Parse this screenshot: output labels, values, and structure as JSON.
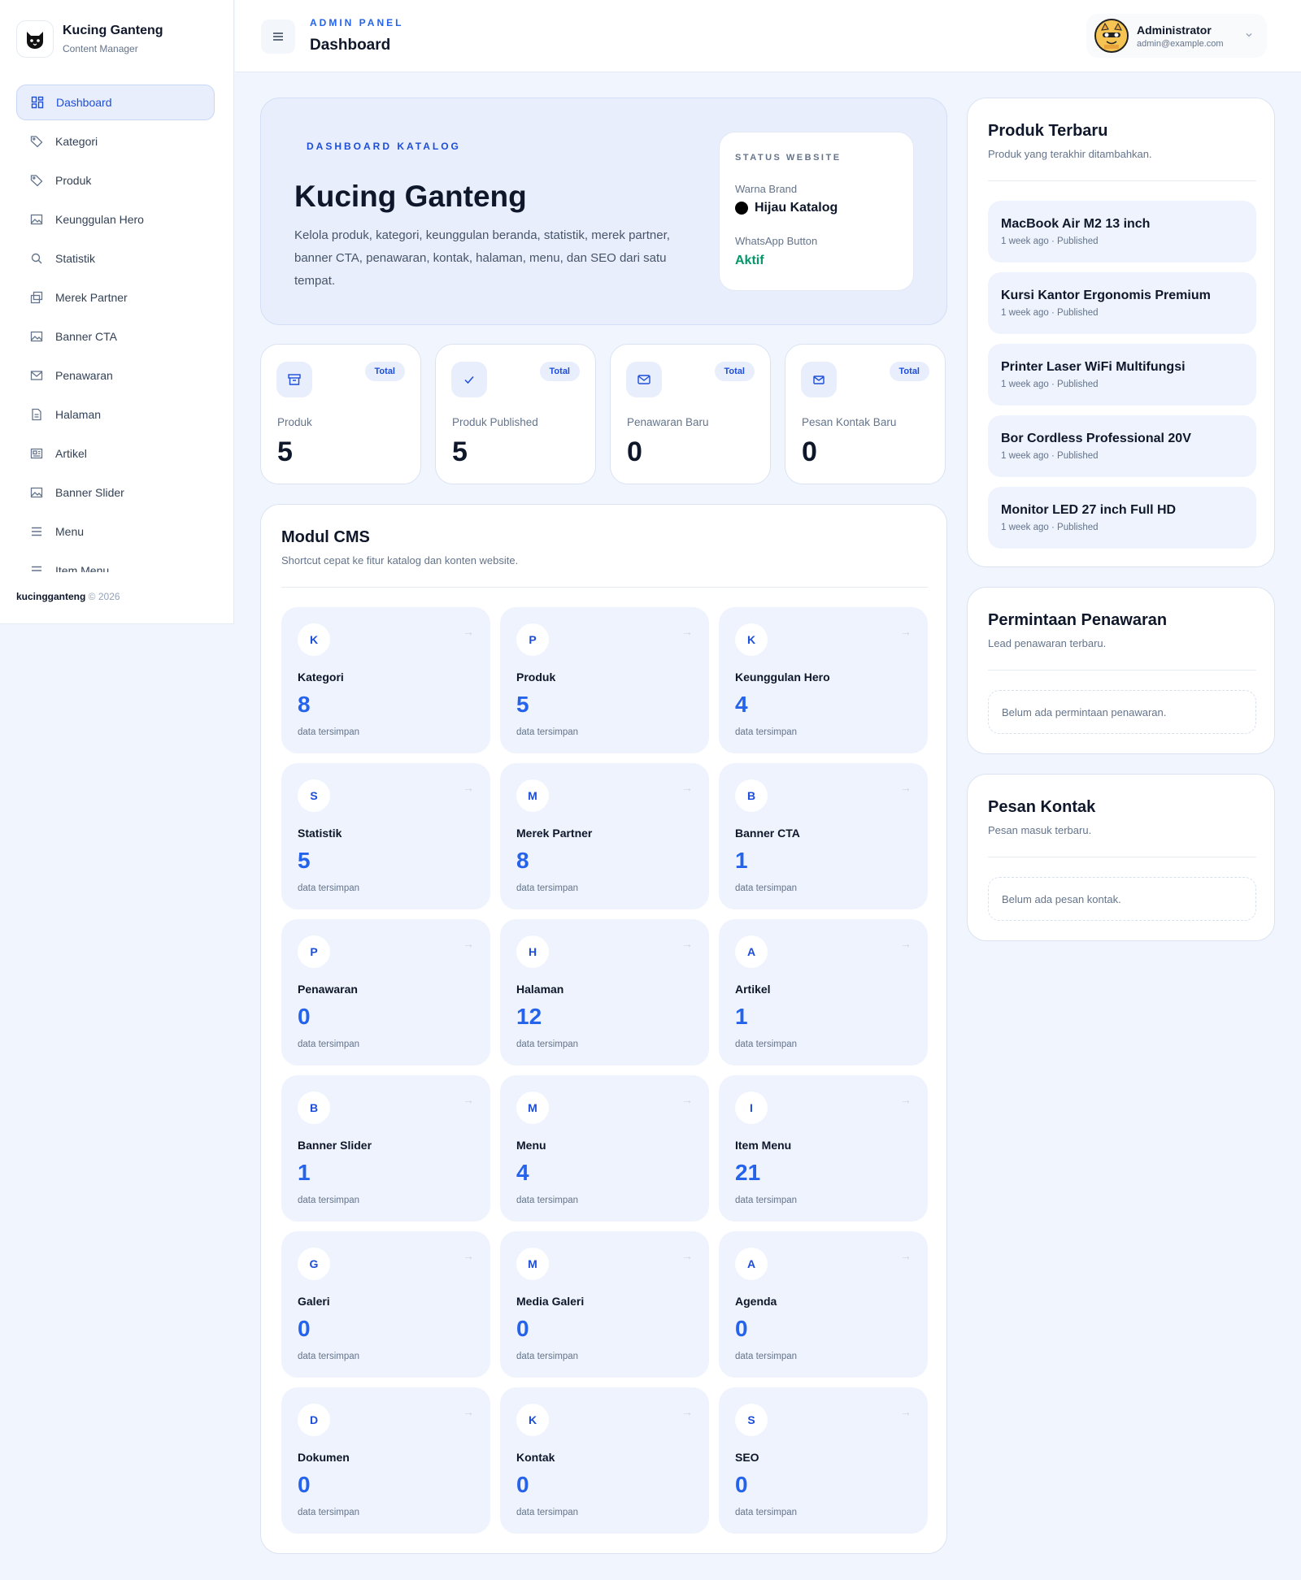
{
  "brand": {
    "name": "Kucing Ganteng",
    "subtitle": "Content Manager",
    "logo_icon": "cat-logo-icon"
  },
  "sidebar": {
    "items": [
      {
        "label": "Dashboard",
        "icon": "dashboard-icon",
        "active": true
      },
      {
        "label": "Kategori",
        "icon": "tag-icon"
      },
      {
        "label": "Produk",
        "icon": "tag-icon"
      },
      {
        "label": "Keunggulan Hero",
        "icon": "image-icon"
      },
      {
        "label": "Statistik",
        "icon": "search-icon"
      },
      {
        "label": "Merek Partner",
        "icon": "copy-icon"
      },
      {
        "label": "Banner CTA",
        "icon": "image-icon"
      },
      {
        "label": "Penawaran",
        "icon": "mail-icon"
      },
      {
        "label": "Halaman",
        "icon": "file-icon"
      },
      {
        "label": "Artikel",
        "icon": "newspaper-icon"
      },
      {
        "label": "Banner Slider",
        "icon": "image-icon"
      },
      {
        "label": "Menu",
        "icon": "list-icon"
      },
      {
        "label": "Item Menu",
        "icon": "list-icon"
      }
    ],
    "footer_brand": "kucingganteng",
    "footer_copy": " © 2026"
  },
  "header": {
    "kicker": "ADMIN PANEL",
    "title": "Dashboard",
    "user_name": "Administrator",
    "user_email": "admin@example.com"
  },
  "hero": {
    "kicker": "DASHBOARD KATALOG",
    "title": "Kucing Ganteng",
    "description": "Kelola produk, kategori, keunggulan beranda, statistik, merek partner, banner CTA, penawaran, kontak, halaman, menu, dan SEO dari satu tempat.",
    "status": {
      "kicker": "STATUS WEBSITE",
      "brand_color_label": "Warna Brand",
      "brand_color_value": "Hijau Katalog",
      "whatsapp_label": "WhatsApp Button",
      "whatsapp_value": "Aktif"
    }
  },
  "stats": [
    {
      "label": "Produk",
      "value": "5",
      "badge": "Total",
      "icon": "archive-icon"
    },
    {
      "label": "Produk Published",
      "value": "5",
      "badge": "Total",
      "icon": "check-icon"
    },
    {
      "label": "Penawaran Baru",
      "value": "0",
      "badge": "Total",
      "icon": "mail-icon"
    },
    {
      "label": "Pesan Kontak Baru",
      "value": "0",
      "badge": "Total",
      "icon": "mail-icon"
    }
  ],
  "cms": {
    "title": "Modul CMS",
    "subtitle": "Shortcut cepat ke fitur katalog dan konten website.",
    "note": "data tersimpan",
    "arrow": "→",
    "modules": [
      {
        "letter": "K",
        "name": "Kategori",
        "count": "8"
      },
      {
        "letter": "P",
        "name": "Produk",
        "count": "5"
      },
      {
        "letter": "K",
        "name": "Keunggulan Hero",
        "count": "4"
      },
      {
        "letter": "S",
        "name": "Statistik",
        "count": "5"
      },
      {
        "letter": "M",
        "name": "Merek Partner",
        "count": "8"
      },
      {
        "letter": "B",
        "name": "Banner CTA",
        "count": "1"
      },
      {
        "letter": "P",
        "name": "Penawaran",
        "count": "0"
      },
      {
        "letter": "H",
        "name": "Halaman",
        "count": "12"
      },
      {
        "letter": "A",
        "name": "Artikel",
        "count": "1"
      },
      {
        "letter": "B",
        "name": "Banner Slider",
        "count": "1"
      },
      {
        "letter": "M",
        "name": "Menu",
        "count": "4"
      },
      {
        "letter": "I",
        "name": "Item Menu",
        "count": "21"
      },
      {
        "letter": "G",
        "name": "Galeri",
        "count": "0"
      },
      {
        "letter": "M",
        "name": "Media Galeri",
        "count": "0"
      },
      {
        "letter": "A",
        "name": "Agenda",
        "count": "0"
      },
      {
        "letter": "D",
        "name": "Dokumen",
        "count": "0"
      },
      {
        "letter": "K",
        "name": "Kontak",
        "count": "0"
      },
      {
        "letter": "S",
        "name": "SEO",
        "count": "0"
      }
    ]
  },
  "latest_products": {
    "title": "Produk Terbaru",
    "subtitle": "Produk yang terakhir ditambahkan.",
    "items": [
      {
        "name": "MacBook Air M2 13 inch",
        "meta": "1 week ago · Published"
      },
      {
        "name": "Kursi Kantor Ergonomis Premium",
        "meta": "1 week ago · Published"
      },
      {
        "name": "Printer Laser WiFi Multifungsi",
        "meta": "1 week ago · Published"
      },
      {
        "name": "Bor Cordless Professional 20V",
        "meta": "1 week ago · Published"
      },
      {
        "name": "Monitor LED 27 inch Full HD",
        "meta": "1 week ago · Published"
      }
    ]
  },
  "offers": {
    "title": "Permintaan Penawaran",
    "subtitle": "Lead penawaran terbaru.",
    "empty": "Belum ada permintaan penawaran."
  },
  "contacts": {
    "title": "Pesan Kontak",
    "subtitle": "Pesan masuk terbaru.",
    "empty": "Belum ada pesan kontak."
  },
  "colors": {
    "accent": "#2563eb",
    "success": "#059669",
    "background": "#f1f5fd"
  }
}
